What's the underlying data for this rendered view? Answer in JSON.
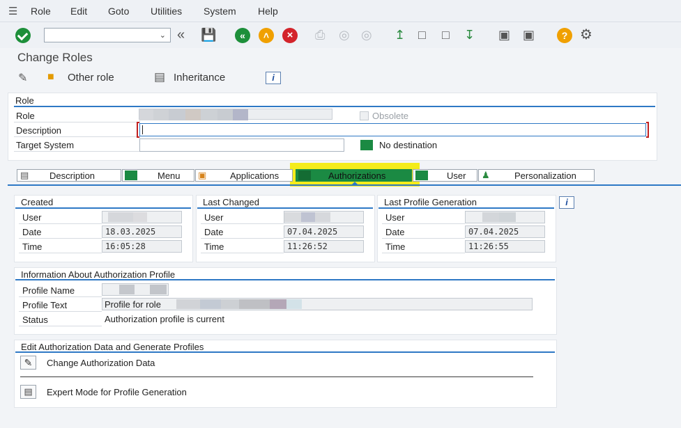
{
  "menubar": {
    "items": [
      {
        "label": "Role"
      },
      {
        "label": "Edit"
      },
      {
        "label": "Goto"
      },
      {
        "label": "Utilities"
      },
      {
        "label": "System"
      },
      {
        "label": "Help"
      }
    ]
  },
  "toolbar": {
    "command_field_value": "",
    "icons": [
      "enter-icon",
      "command-dropdown-icon",
      "back-arrows-icon",
      "save-icon",
      "back-icon",
      "exit-icon",
      "cancel-icon",
      "print-icon",
      "find-icon",
      "find-next-icon",
      "first-page-icon",
      "previous-page-icon",
      "next-page-icon",
      "last-page-icon",
      "create-session-icon",
      "shortcut-icon",
      "help-icon",
      "settings-icon"
    ]
  },
  "page_title": "Change Roles",
  "app_toolbar": {
    "other_role_label": "Other role",
    "inheritance_label": "Inheritance",
    "info_label": "i"
  },
  "role_panel": {
    "title": "Role",
    "role_label": "Role",
    "description_label": "Description",
    "target_system_label": "Target System",
    "description_value": "",
    "target_system_value": "",
    "obsolete_label": "Obsolete",
    "no_destination_label": "No destination"
  },
  "tabs": [
    {
      "label": "Description"
    },
    {
      "label": "Menu"
    },
    {
      "label": "Applications"
    },
    {
      "label": "Authorizations"
    },
    {
      "label": "User"
    },
    {
      "label": "Personalization"
    }
  ],
  "created": {
    "title": "Created",
    "user_label": "User",
    "date_label": "Date",
    "time_label": "Time",
    "date": "18.03.2025",
    "time": "16:05:28"
  },
  "last_changed": {
    "title": "Last Changed",
    "user_label": "User",
    "date_label": "Date",
    "time_label": "Time",
    "date": "07.04.2025",
    "time": "11:26:52"
  },
  "last_profile_generation": {
    "title": "Last Profile Generation",
    "user_label": "User",
    "date_label": "Date",
    "time_label": "Time",
    "date": "07.04.2025",
    "time": "11:26:55"
  },
  "profile_info": {
    "title": "Information About Authorization Profile",
    "profile_name_label": "Profile Name",
    "profile_text_label": "Profile Text",
    "status_label": "Status",
    "profile_text_prefix": "Profile for role",
    "status_value": "Authorization profile is current"
  },
  "edit_auth": {
    "title": "Edit Authorization Data and Generate Profiles",
    "change_auth_label": "Change Authorization Data",
    "expert_mode_label": "Expert Mode for Profile Generation"
  },
  "colors": {
    "accent_blue": "#2e78c5",
    "green": "#1b8a43",
    "highlight_yellow": "#f4ec1b",
    "cancel_red": "#d3242b",
    "orange": "#f0a000"
  }
}
